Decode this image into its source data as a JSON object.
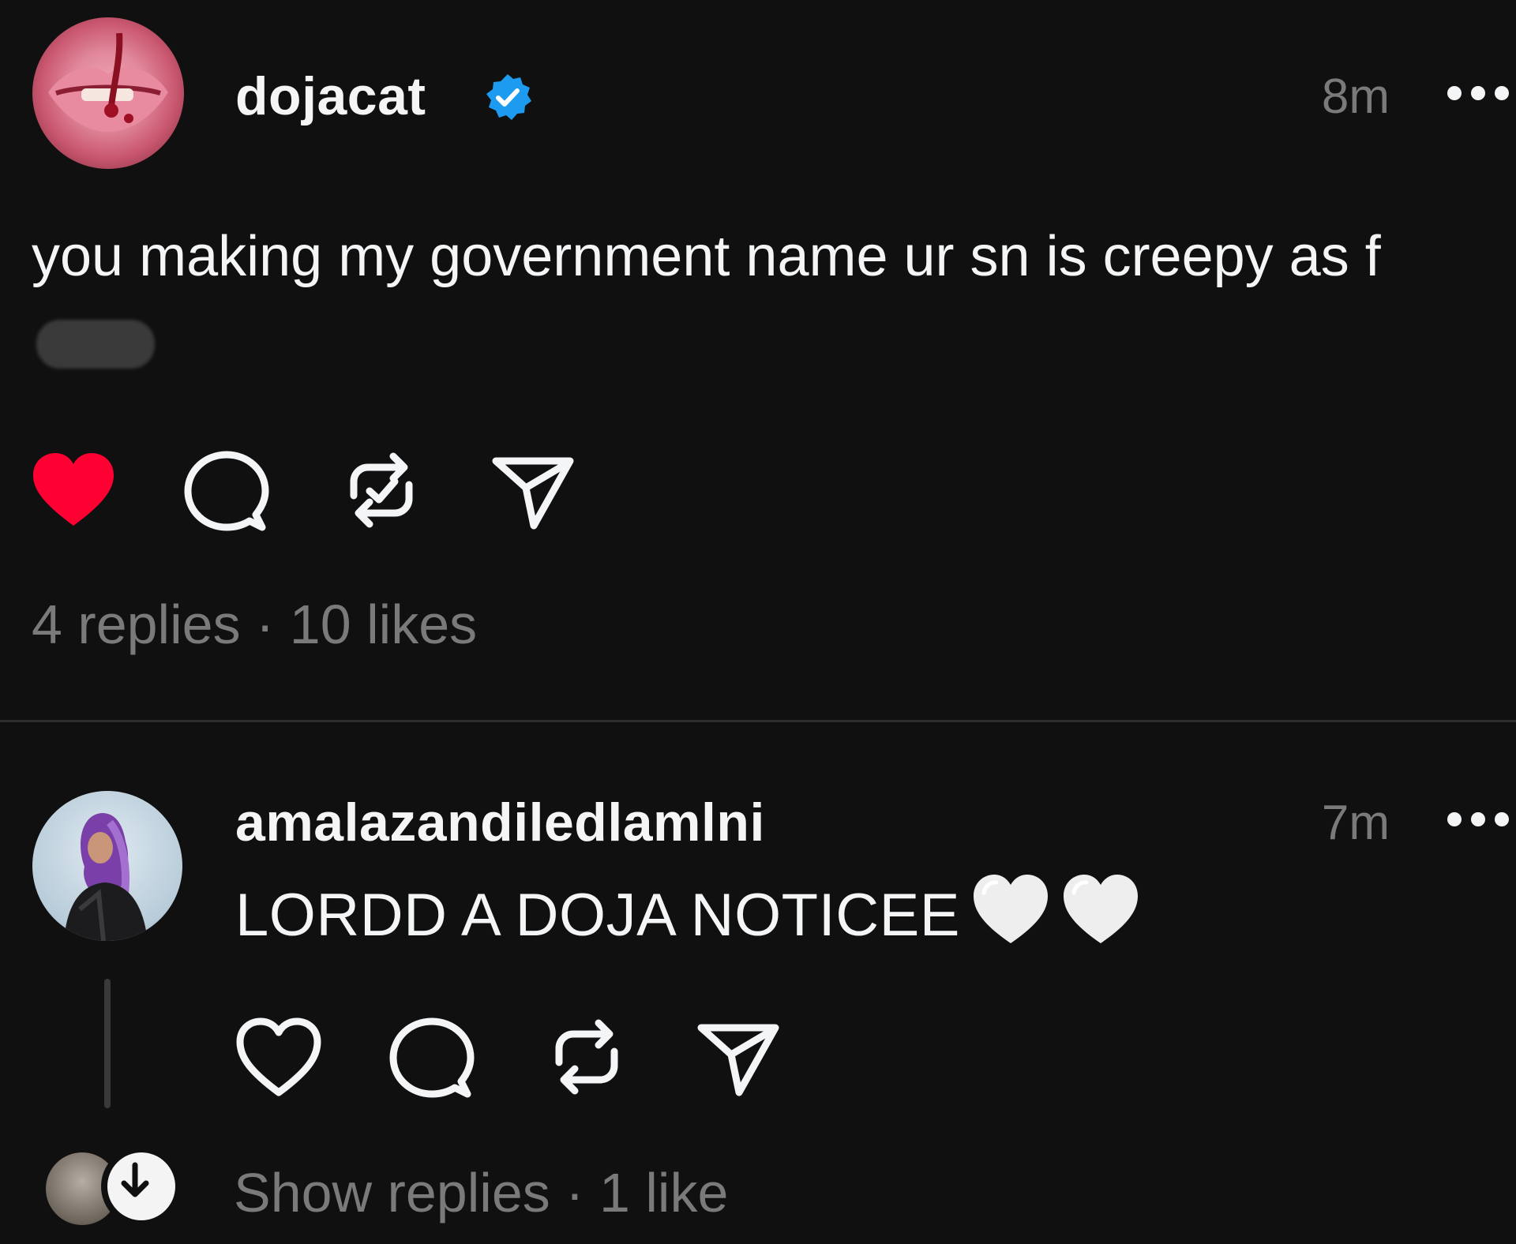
{
  "main_post": {
    "username": "dojacat",
    "verified": true,
    "time": "8m",
    "text": "you making my government name ur sn is creepy as f",
    "liked": true,
    "counts": "4 replies · 10 likes"
  },
  "reply_post": {
    "username": "amalazandiledlamlni",
    "time": "7m",
    "text": "LORDD A DOJA NOTICEE",
    "liked": false,
    "counts": "Show replies · 1 like"
  },
  "colors": {
    "background": "#101010",
    "text": "#f3f5f7",
    "muted": "#7a7a7a",
    "like_red": "#ff0033",
    "verified_blue": "#1d9bf0"
  },
  "icons": [
    "heart-icon",
    "comment-icon",
    "repost-icon",
    "share-icon",
    "more-icon",
    "verified-icon",
    "white-heart-emoji",
    "arrow-down-icon"
  ]
}
